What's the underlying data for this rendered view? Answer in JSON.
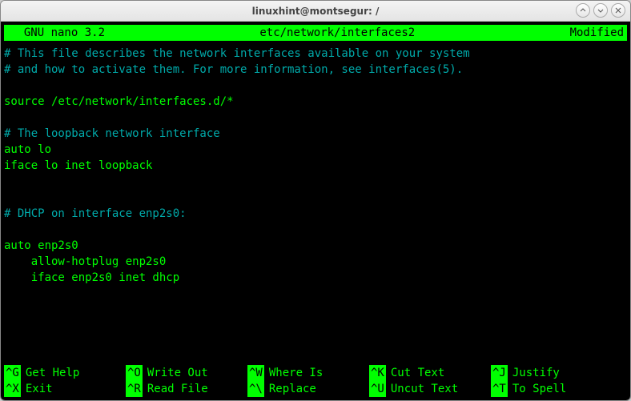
{
  "window": {
    "title": "linuxhint@montsegur: /"
  },
  "header": {
    "left": "  GNU nano 3.2",
    "center": "etc/network/interfaces2",
    "right": "Modified"
  },
  "lines": [
    {
      "text": "# This file describes the network interfaces available on your system",
      "cls": "comment"
    },
    {
      "text": "# and how to activate them. For more information, see interfaces(5).",
      "cls": "comment"
    },
    {
      "text": "",
      "cls": ""
    },
    {
      "text": "source /etc/network/interfaces.d/*",
      "cls": ""
    },
    {
      "text": "",
      "cls": ""
    },
    {
      "text": "# The loopback network interface",
      "cls": "comment"
    },
    {
      "text": "auto lo",
      "cls": ""
    },
    {
      "text": "iface lo inet loopback",
      "cls": ""
    },
    {
      "text": "",
      "cls": ""
    },
    {
      "text": "",
      "cls": ""
    },
    {
      "text": "# DHCP on interface enp2s0:",
      "cls": "comment"
    },
    {
      "text": "",
      "cls": ""
    },
    {
      "text": "auto enp2s0",
      "cls": ""
    },
    {
      "text": "    allow-hotplug enp2s0",
      "cls": ""
    },
    {
      "text": "    iface enp2s0 inet dhcp",
      "cls": ""
    }
  ],
  "shortcuts": {
    "row1": [
      {
        "key": "^G",
        "label": "Get Help"
      },
      {
        "key": "^O",
        "label": "Write Out"
      },
      {
        "key": "^W",
        "label": "Where Is"
      },
      {
        "key": "^K",
        "label": "Cut Text"
      },
      {
        "key": "^J",
        "label": "Justify"
      }
    ],
    "row2": [
      {
        "key": "^X",
        "label": "Exit"
      },
      {
        "key": "^R",
        "label": "Read File"
      },
      {
        "key": "^\\",
        "label": "Replace"
      },
      {
        "key": "^U",
        "label": "Uncut Text"
      },
      {
        "key": "^T",
        "label": "To Spell"
      }
    ]
  }
}
